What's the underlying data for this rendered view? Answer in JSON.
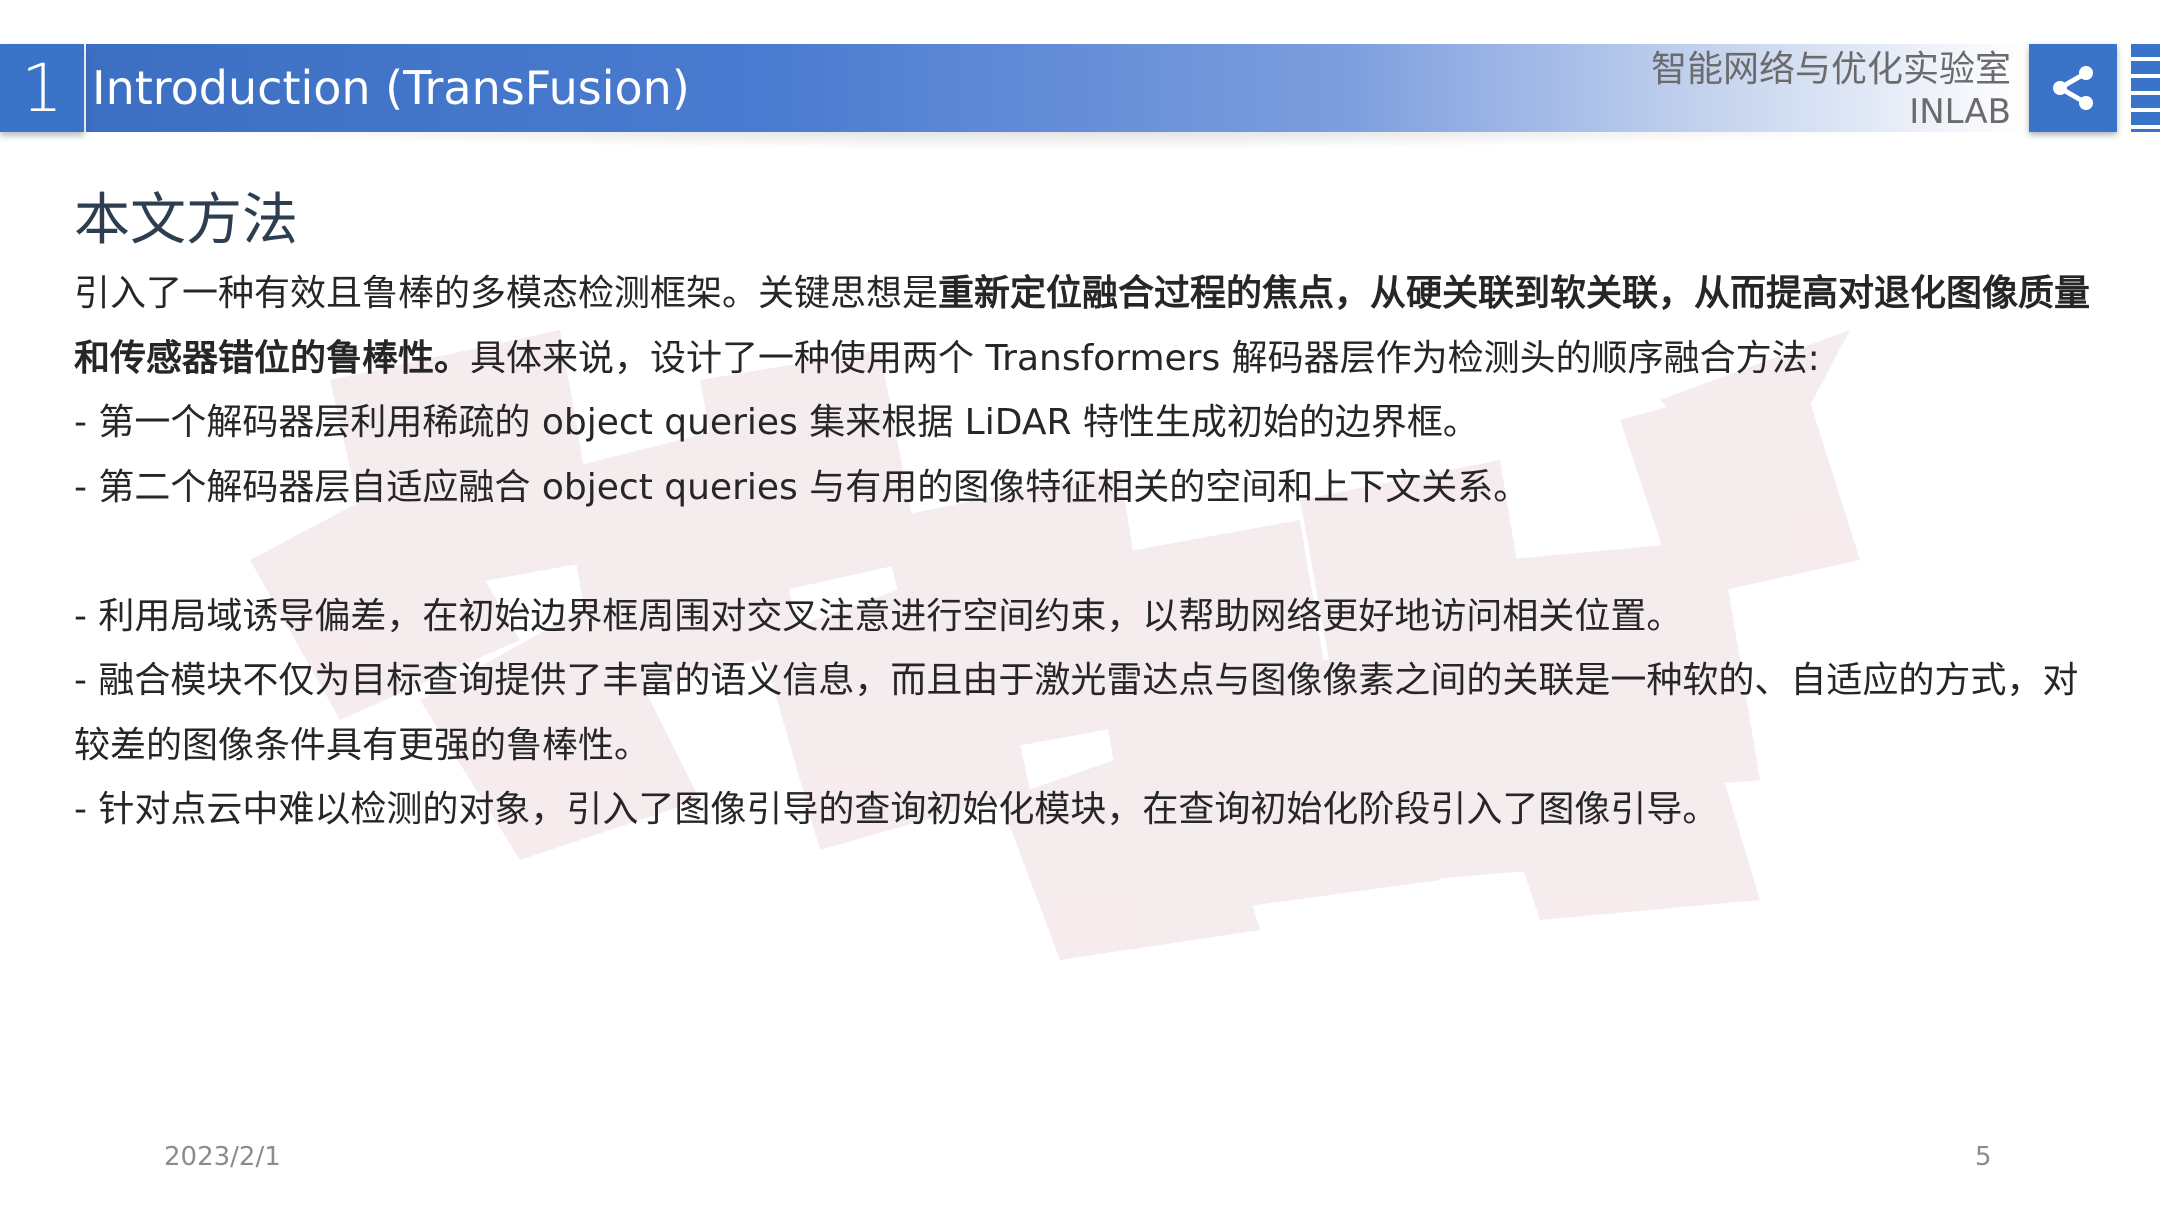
{
  "header": {
    "section_number": "1",
    "title": "Introduction (TransFusion)",
    "org_name": "智能网络与优化实验室",
    "org_abbr": "INLAB",
    "share_icon": "share-icon"
  },
  "colors": {
    "accent_blue": "#3a74c8",
    "heading": "#2d3e50",
    "body_text": "#262626",
    "footer_text": "#8c8c8c"
  },
  "content": {
    "heading": "本文方法",
    "p1_normal_a": "引入了一种有效且鲁棒的多模态检测框架。关键思想是",
    "p1_bold": "重新定位融合过程的焦点，从硬关联到软关联，从而提高对退化图像质量和传感器错位的鲁棒性。",
    "p1_normal_b": "具体来说，设计了一种使用两个 Transformers 解码器层作为检测头的顺序融合方法:",
    "bullet1": "- 第一个解码器层利用稀疏的 object queries 集来根据 LiDAR 特性生成初始的边界框。",
    "bullet2": "- 第二个解码器层自适应融合 object queries 与有用的图像特征相关的空间和上下文关系。",
    "bullet3": "- 利用局域诱导偏差，在初始边界框周围对交叉注意进行空间约束，以帮助网络更好地访问相关位置。",
    "bullet4": "- 融合模块不仅为目标查询提供了丰富的语义信息，而且由于激光雷达点与图像像素之间的关联是一种软的、自适应的方式，对较差的图像条件具有更强的鲁棒性。",
    "bullet5": "- 针对点云中难以检测的对象，引入了图像引导的查询初始化模块，在查询初始化阶段引入了图像引导。"
  },
  "footer": {
    "date": "2023/2/1",
    "page": "5"
  }
}
